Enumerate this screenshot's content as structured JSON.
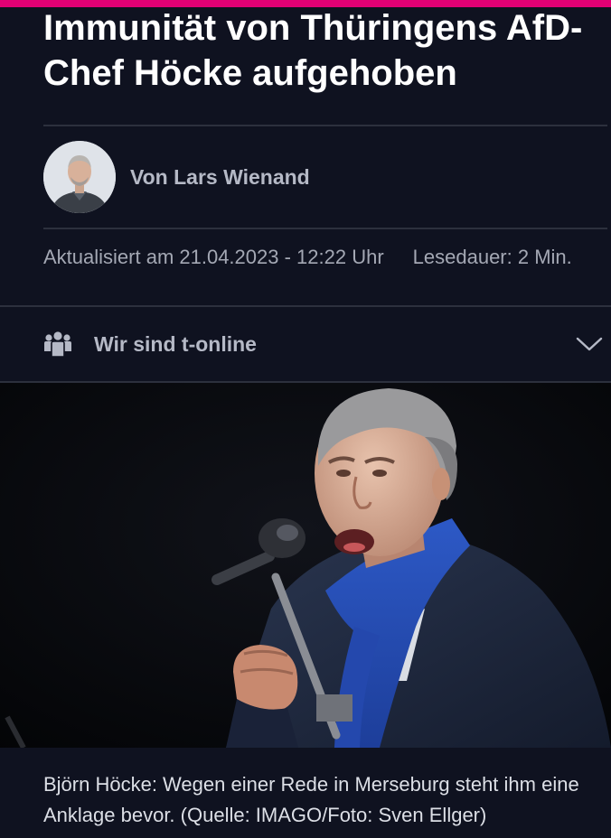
{
  "article": {
    "headline": "Immunität von Thüringens AfD-Chef Höcke aufgehoben",
    "author": "Von Lars Wienand",
    "updated": "Aktualisiert am 21.04.2023 - 12:22 Uhr",
    "read_time": "Lesedauer: 2 Min."
  },
  "accordion": {
    "label": "Wir sind t-online",
    "icon": "people-group-icon",
    "expand_icon": "chevron-down-icon"
  },
  "hero": {
    "caption": "Björn Höcke: Wegen einer Rede in Merseburg steht ihm eine Anklage bevor. (Quelle: IMAGO/Foto: Sven Ellger)"
  },
  "colors": {
    "background": "#0f1220",
    "accent": "#e20074",
    "divider": "#2c303d",
    "muted_text": "#a4a8b4",
    "label_text": "#b5b9c6"
  }
}
